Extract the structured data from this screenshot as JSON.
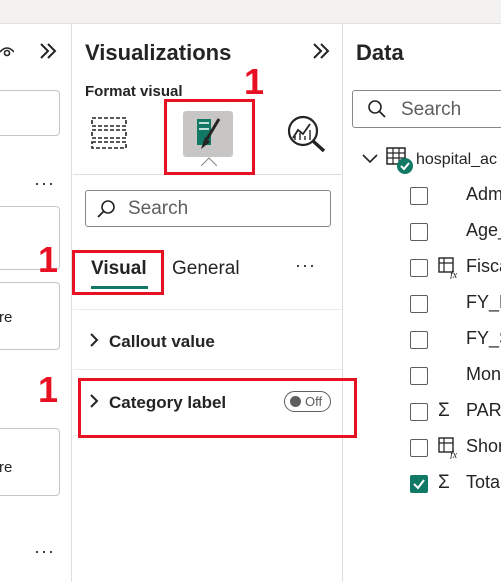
{
  "visualizations": {
    "title": "Visualizations",
    "format_label": "Format visual",
    "search_placeholder": "Search",
    "tabs": [
      {
        "label": "Visual",
        "selected": true
      },
      {
        "label": "General",
        "selected": false
      }
    ],
    "more": "···",
    "sections": [
      {
        "label": "Callout value"
      },
      {
        "label": "Category label",
        "toggle": "Off"
      }
    ]
  },
  "data_pane": {
    "title": "Data",
    "search_placeholder": "Search",
    "table": "hospital_ac",
    "fields": [
      {
        "name": "Adm",
        "icon": "",
        "checked": false
      },
      {
        "name": "Age_",
        "icon": "",
        "checked": false
      },
      {
        "name": "Fisca",
        "icon": "calc-table-icon",
        "checked": false
      },
      {
        "name": "FY_E",
        "icon": "",
        "checked": false
      },
      {
        "name": "FY_S",
        "icon": "",
        "checked": false
      },
      {
        "name": "Mon",
        "icon": "",
        "checked": false
      },
      {
        "name": "PART",
        "icon": "sigma-icon",
        "checked": false
      },
      {
        "name": "Shor",
        "icon": "calc-table-icon",
        "checked": false
      },
      {
        "name": "Tota",
        "icon": "sigma-icon",
        "checked": true
      }
    ]
  },
  "left_pane": {
    "dots": "···",
    "items": [
      "re",
      "re"
    ]
  },
  "annotations": [
    "1",
    "1",
    "1"
  ],
  "colors": {
    "accent": "#117865",
    "annotation": "#e81123"
  }
}
